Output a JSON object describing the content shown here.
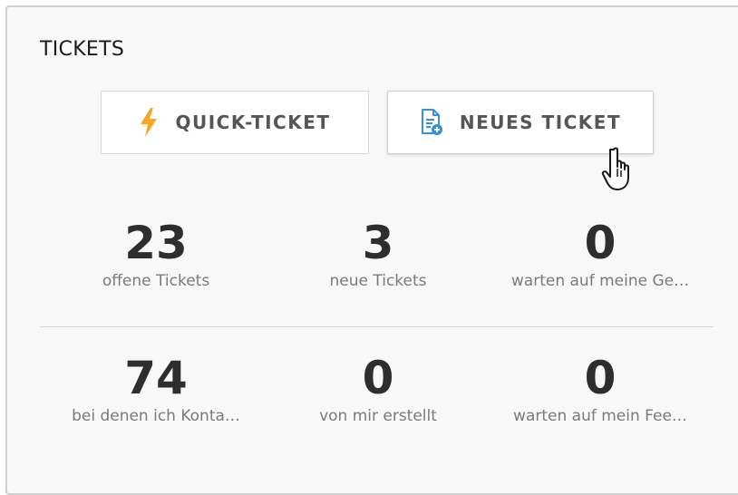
{
  "card": {
    "title": "TICKETS"
  },
  "buttons": {
    "quick": {
      "label": "QUICK-TICKET",
      "icon": "lightning-icon"
    },
    "new": {
      "label": "NEUES TICKET",
      "icon": "new-document-icon"
    }
  },
  "stats": [
    {
      "value": "23",
      "label": "offene Tickets"
    },
    {
      "value": "3",
      "label": "neue Tickets"
    },
    {
      "value": "0",
      "label": "warten auf meine Ge…"
    },
    {
      "value": "74",
      "label": "bei denen ich Konta…"
    },
    {
      "value": "0",
      "label": "von mir erstellt"
    },
    {
      "value": "0",
      "label": "warten auf mein Fee…"
    }
  ],
  "colors": {
    "accent_lightning": "#f5a623",
    "accent_document": "#3b8fd9",
    "card_background": "#f8f8f8"
  }
}
